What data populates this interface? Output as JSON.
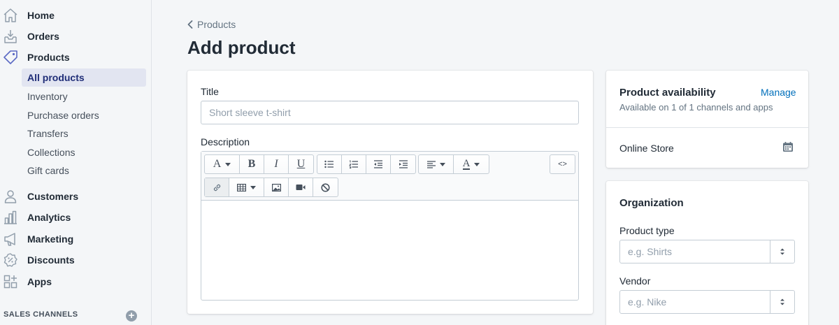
{
  "sidebar": {
    "items": [
      {
        "label": "Home",
        "icon": "home-icon"
      },
      {
        "label": "Orders",
        "icon": "orders-icon"
      },
      {
        "label": "Products",
        "icon": "tag-icon"
      },
      {
        "label": "Customers",
        "icon": "person-icon"
      },
      {
        "label": "Analytics",
        "icon": "bar-chart-icon"
      },
      {
        "label": "Marketing",
        "icon": "megaphone-icon"
      },
      {
        "label": "Discounts",
        "icon": "discount-icon"
      },
      {
        "label": "Apps",
        "icon": "apps-icon"
      }
    ],
    "products_sub": [
      {
        "label": "All products",
        "active": true
      },
      {
        "label": "Inventory"
      },
      {
        "label": "Purchase orders"
      },
      {
        "label": "Transfers"
      },
      {
        "label": "Collections"
      },
      {
        "label": "Gift cards"
      }
    ],
    "sales_channels_label": "SALES CHANNELS"
  },
  "header": {
    "breadcrumb": "Products",
    "title": "Add product"
  },
  "main_card": {
    "title_label": "Title",
    "title_placeholder": "Short sleeve t-shirt",
    "description_label": "Description",
    "toolbar": {
      "bold": "B",
      "italic": "I",
      "underline": "U",
      "html": "<>"
    }
  },
  "availability": {
    "heading": "Product availability",
    "manage_label": "Manage",
    "summary": "Available on 1 of 1 channels and apps",
    "channel": "Online Store"
  },
  "organization": {
    "heading": "Organization",
    "product_type_label": "Product type",
    "product_type_placeholder": "e.g. Shirts",
    "vendor_label": "Vendor",
    "vendor_placeholder": "e.g. Nike"
  },
  "colors": {
    "active_bg": "#e2e5f1",
    "active_text": "#202e78",
    "link": "#006fbb",
    "nav_icon": "#5c6ac4"
  }
}
